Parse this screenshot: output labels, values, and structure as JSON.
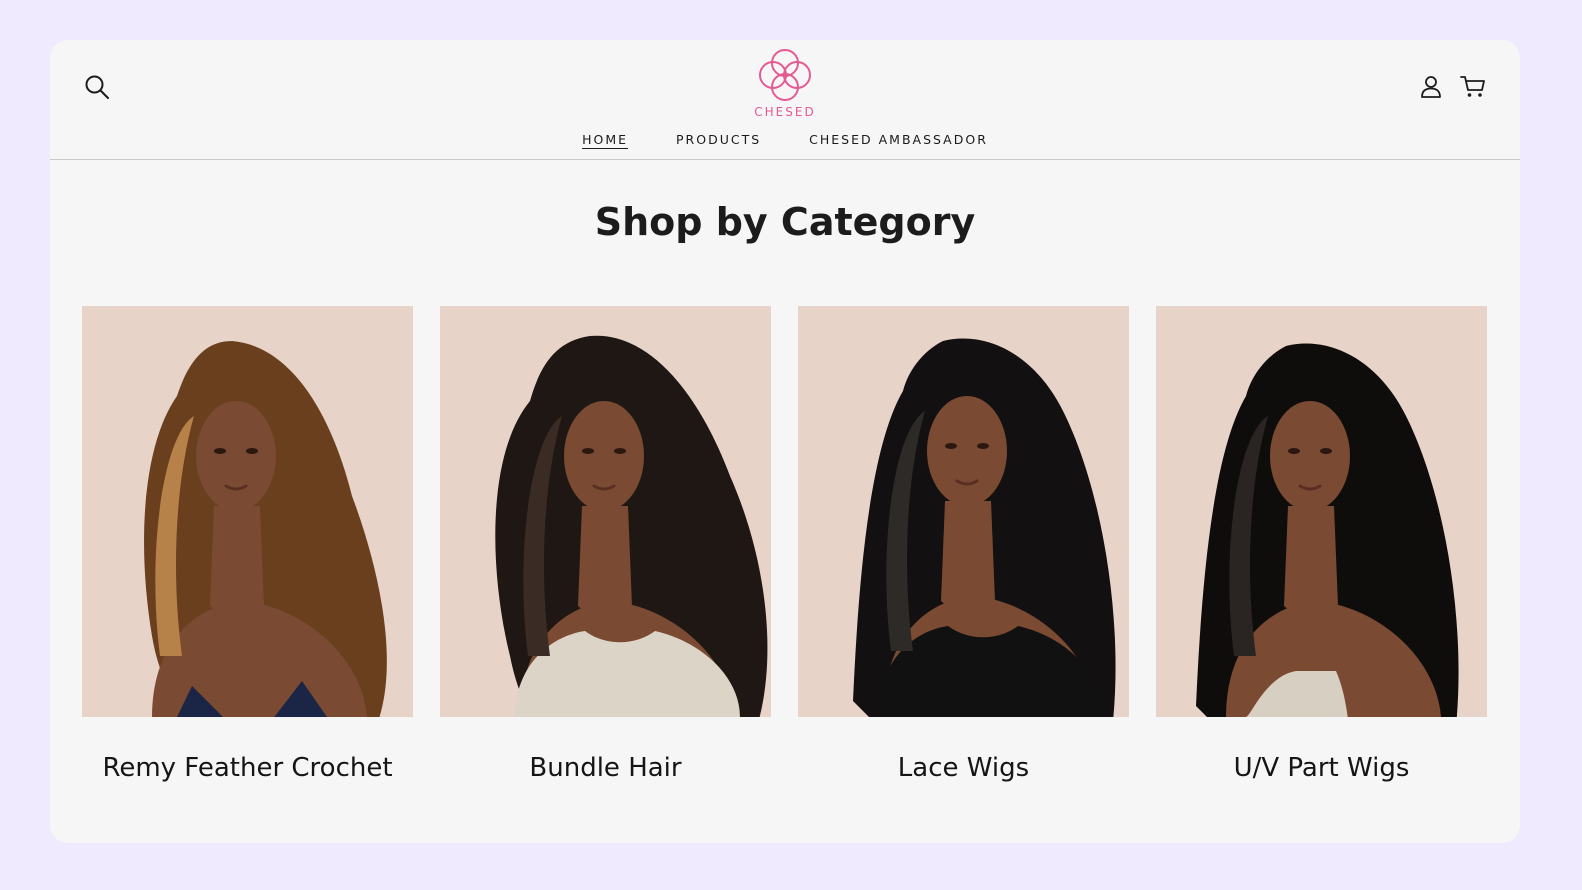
{
  "header": {
    "logo_text": "CHESED",
    "brand_color": "#e55a93",
    "icons": {
      "search": "search-icon",
      "account": "account-icon",
      "cart": "cart-icon"
    },
    "nav": [
      {
        "label": "HOME",
        "active": true
      },
      {
        "label": "PRODUCTS",
        "active": false
      },
      {
        "label": "CHESED AMBASSADOR",
        "active": false
      }
    ]
  },
  "main": {
    "section_title": "Shop by Category",
    "categories": [
      {
        "label": "Remy Feather Crochet",
        "hair_color": "#6a3f1e",
        "hair_highlight": "#b7824a",
        "top_color": "#1b2545"
      },
      {
        "label": "Bundle Hair",
        "hair_color": "#1e1714",
        "hair_highlight": "#3a2c24",
        "top_color": "#dcd4c7"
      },
      {
        "label": "Lace Wigs",
        "hair_color": "#121010",
        "hair_highlight": "#2e2a28",
        "top_color": "#111111"
      },
      {
        "label": "U/V Part Wigs",
        "hair_color": "#0f0d0c",
        "hair_highlight": "#2a2522",
        "top_color": "#d8cfc3"
      }
    ],
    "image_background": "#e7d3c8",
    "skin_color": "#7a4a33"
  }
}
